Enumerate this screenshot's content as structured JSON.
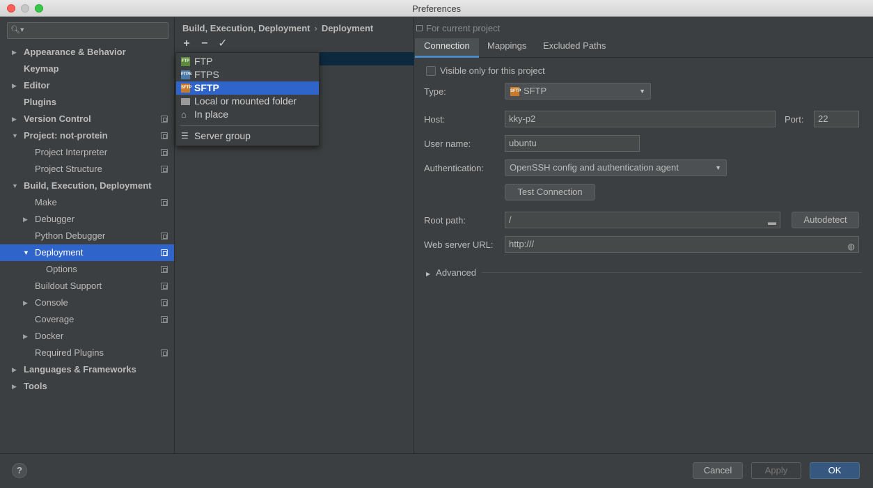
{
  "window": {
    "title": "Preferences"
  },
  "search": {
    "placeholder": ""
  },
  "tree": [
    {
      "label": "Appearance & Behavior",
      "bold": true,
      "arrow": "right",
      "indent": 0,
      "copy": false
    },
    {
      "label": "Keymap",
      "bold": true,
      "arrow": "",
      "indent": 0,
      "copy": false
    },
    {
      "label": "Editor",
      "bold": true,
      "arrow": "right",
      "indent": 0,
      "copy": false
    },
    {
      "label": "Plugins",
      "bold": true,
      "arrow": "",
      "indent": 0,
      "copy": false
    },
    {
      "label": "Version Control",
      "bold": true,
      "arrow": "right",
      "indent": 0,
      "copy": true
    },
    {
      "label": "Project: not-protein",
      "bold": true,
      "arrow": "down",
      "indent": 0,
      "copy": true
    },
    {
      "label": "Project Interpreter",
      "bold": false,
      "arrow": "",
      "indent": 1,
      "copy": true
    },
    {
      "label": "Project Structure",
      "bold": false,
      "arrow": "",
      "indent": 1,
      "copy": true
    },
    {
      "label": "Build, Execution, Deployment",
      "bold": true,
      "arrow": "down",
      "indent": 0,
      "copy": false
    },
    {
      "label": "Make",
      "bold": false,
      "arrow": "",
      "indent": 1,
      "copy": true
    },
    {
      "label": "Debugger",
      "bold": false,
      "arrow": "right",
      "indent": 1,
      "copy": false
    },
    {
      "label": "Python Debugger",
      "bold": false,
      "arrow": "",
      "indent": 1,
      "copy": true
    },
    {
      "label": "Deployment",
      "bold": false,
      "arrow": "down",
      "indent": 1,
      "copy": true,
      "selected": true
    },
    {
      "label": "Options",
      "bold": false,
      "arrow": "",
      "indent": 2,
      "copy": true
    },
    {
      "label": "Buildout Support",
      "bold": false,
      "arrow": "",
      "indent": 1,
      "copy": true
    },
    {
      "label": "Console",
      "bold": false,
      "arrow": "right",
      "indent": 1,
      "copy": true
    },
    {
      "label": "Coverage",
      "bold": false,
      "arrow": "",
      "indent": 1,
      "copy": true
    },
    {
      "label": "Docker",
      "bold": false,
      "arrow": "right",
      "indent": 1,
      "copy": false
    },
    {
      "label": "Required Plugins",
      "bold": false,
      "arrow": "",
      "indent": 1,
      "copy": true
    },
    {
      "label": "Languages & Frameworks",
      "bold": true,
      "arrow": "right",
      "indent": 0,
      "copy": false
    },
    {
      "label": "Tools",
      "bold": true,
      "arrow": "right",
      "indent": 0,
      "copy": false
    }
  ],
  "breadcrumb": {
    "parent": "Build, Execution, Deployment",
    "current": "Deployment"
  },
  "toolbar": {
    "add": "+",
    "remove": "−",
    "apply": "✓"
  },
  "popup": {
    "items": [
      {
        "label": "FTP",
        "icon": "ftp-icon"
      },
      {
        "label": "FTPS",
        "icon": "ftps-icon"
      },
      {
        "label": "SFTP",
        "icon": "sftp-icon",
        "selected": true
      },
      {
        "label": "Local or mounted folder",
        "icon": "folder-icon"
      },
      {
        "label": "In place",
        "icon": "home-icon"
      }
    ],
    "group": {
      "label": "Server group",
      "icon": "server-group-icon"
    }
  },
  "right": {
    "for_current": "For current project",
    "tabs": [
      "Connection",
      "Mappings",
      "Excluded Paths"
    ],
    "visible_only": "Visible only for this project",
    "type_label": "Type:",
    "type_value": "SFTP",
    "host_label": "Host:",
    "host_value": "kky-p2",
    "port_label": "Port:",
    "port_value": "22",
    "user_label": "User name:",
    "user_value": "ubuntu",
    "auth_label": "Authentication:",
    "auth_value": "OpenSSH config and authentication agent",
    "test_button": "Test Connection",
    "root_label": "Root path:",
    "root_value": "/",
    "autodetect_button": "Autodetect",
    "url_label": "Web server URL:",
    "url_value": "http:///",
    "advanced": "Advanced"
  },
  "bottom": {
    "help": "?",
    "cancel": "Cancel",
    "apply": "Apply",
    "ok": "OK"
  },
  "colors": {
    "selection": "#2f65ca",
    "ok_button": "#365880",
    "tab_underline": "#4a88c7"
  }
}
